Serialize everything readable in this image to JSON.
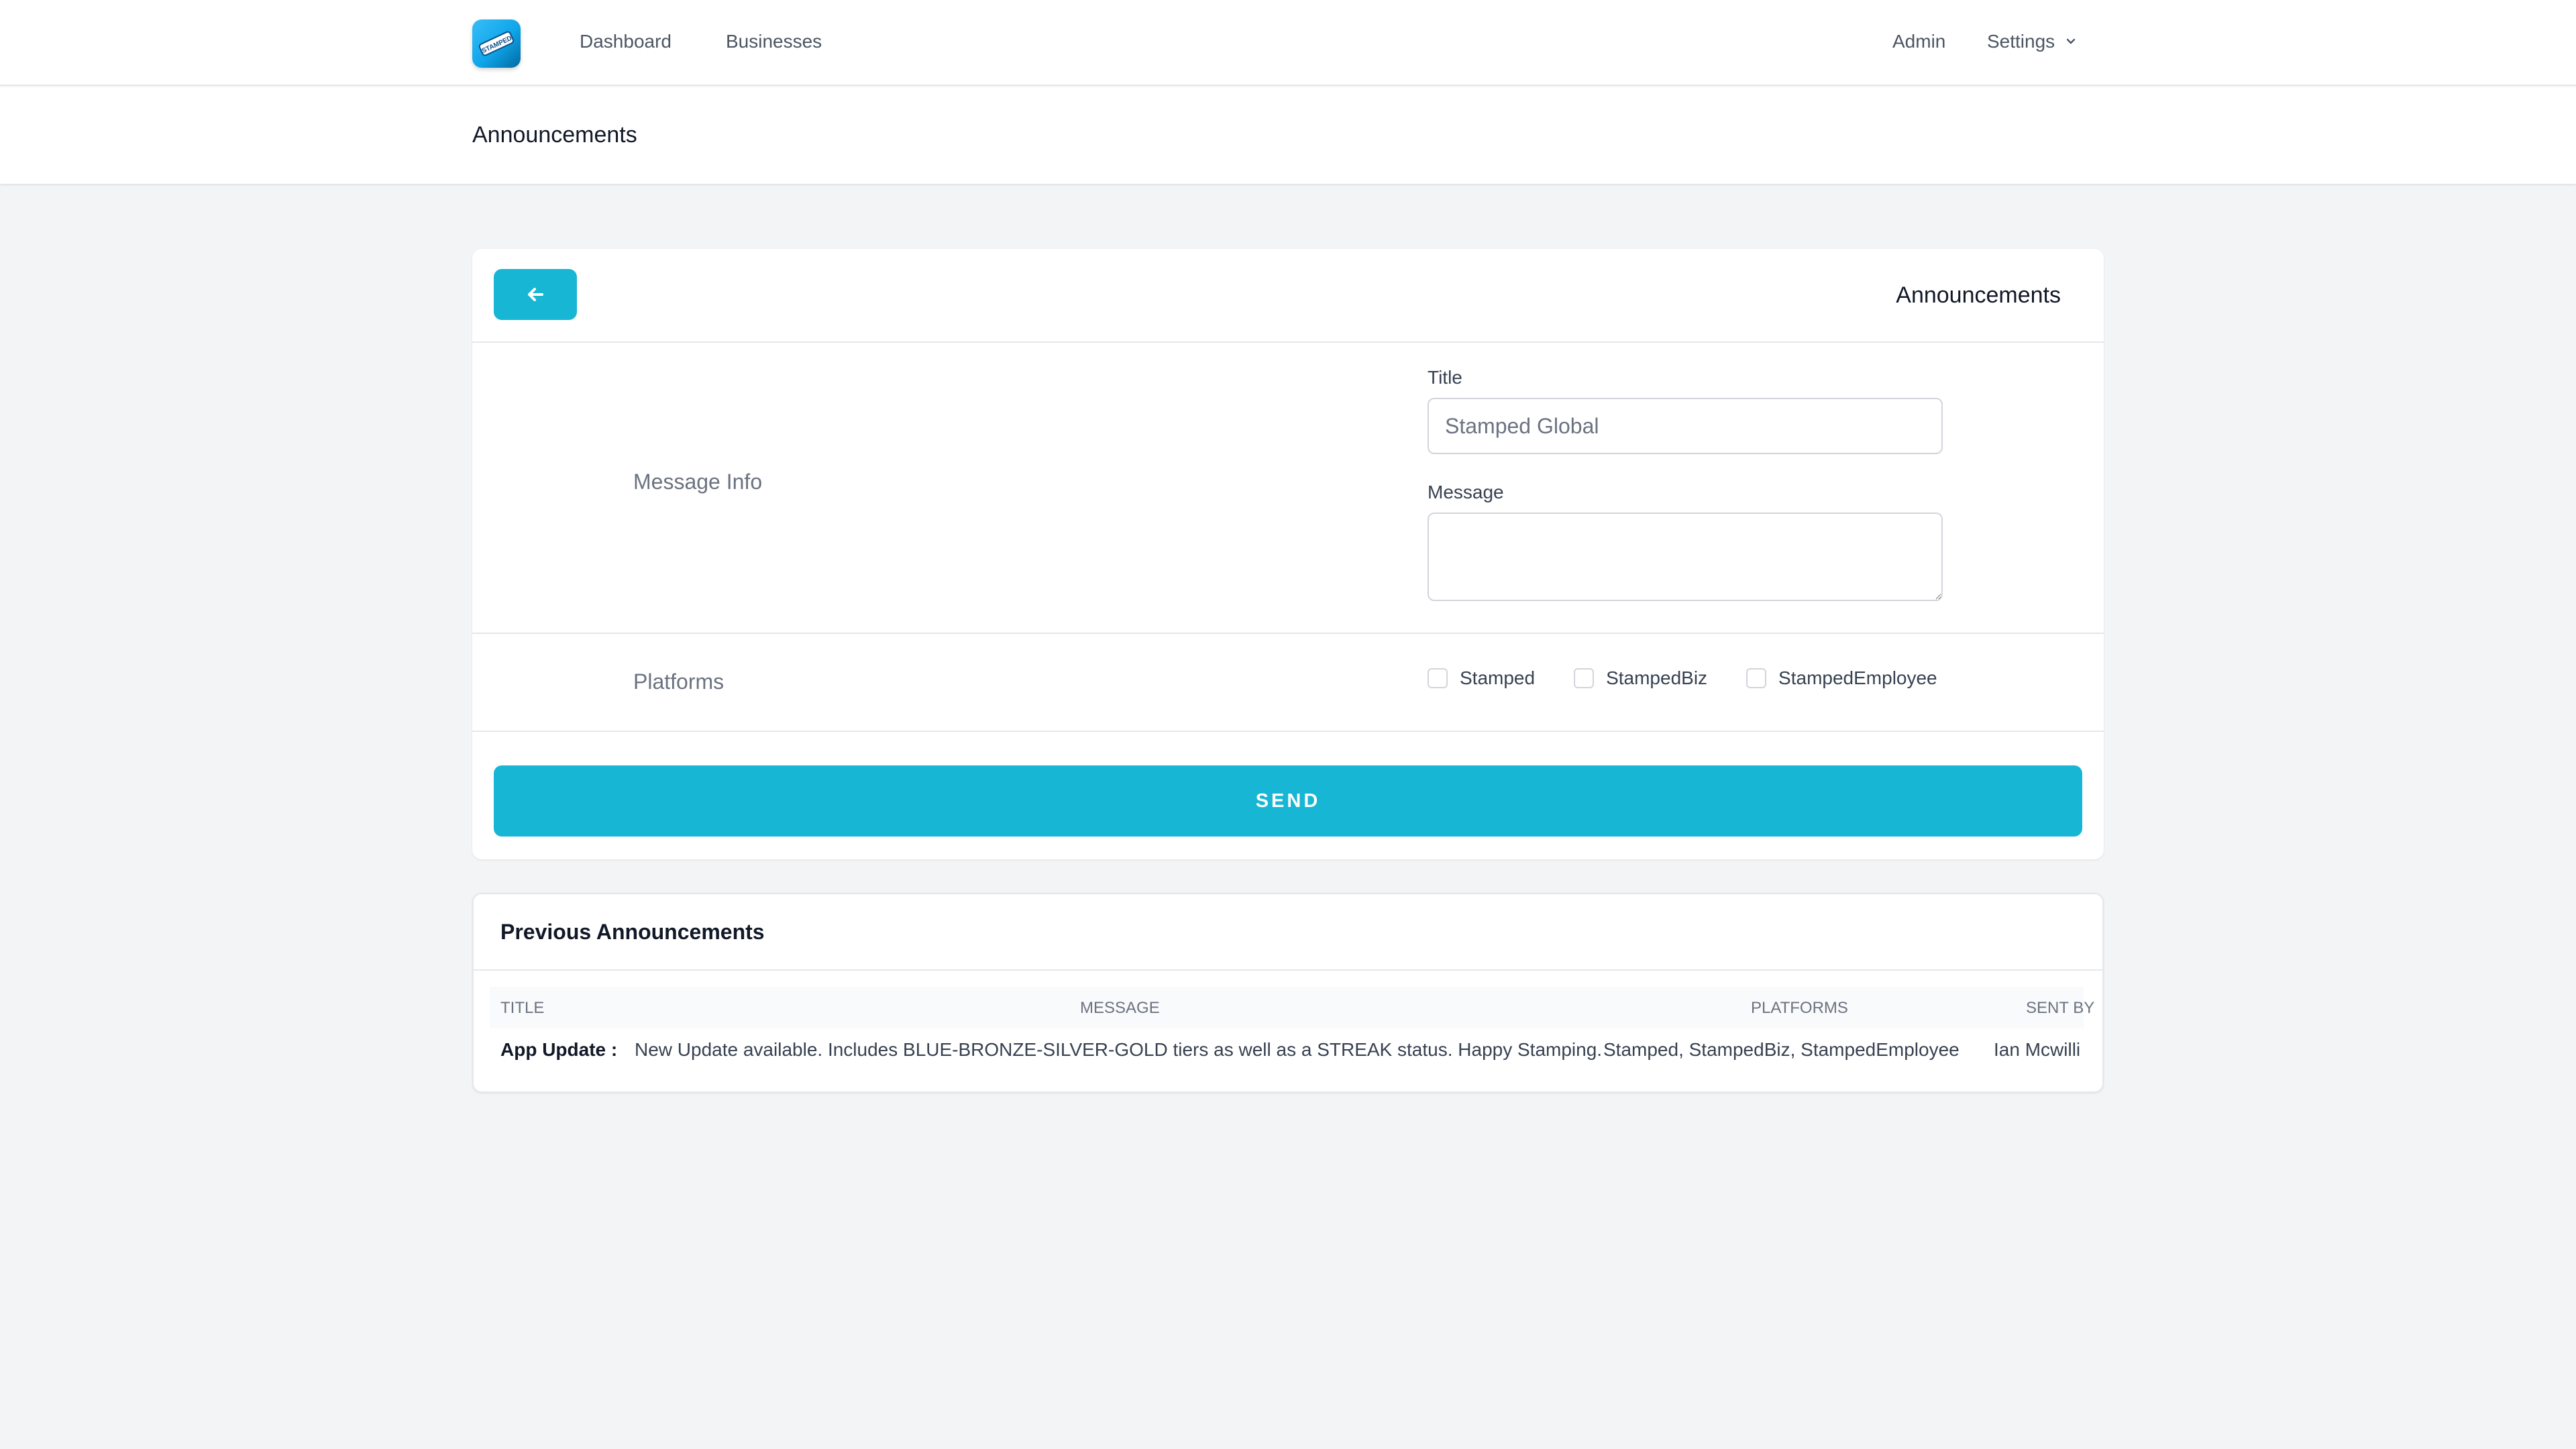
{
  "nav": {
    "logo_text": "STAMPED",
    "links": [
      "Dashboard",
      "Businesses"
    ],
    "admin": "Admin",
    "settings": "Settings"
  },
  "page": {
    "title": "Announcements"
  },
  "form": {
    "title": "Announcements",
    "sections": {
      "message_info": "Message Info",
      "platforms": "Platforms"
    },
    "fields": {
      "title_label": "Title",
      "title_value": "Stamped Global",
      "message_label": "Message",
      "message_value": ""
    },
    "platforms": [
      {
        "label": "Stamped",
        "checked": false
      },
      {
        "label": "StampedBiz",
        "checked": false
      },
      {
        "label": "StampedEmployee",
        "checked": false
      }
    ],
    "send_label": "SEND"
  },
  "previous": {
    "title": "Previous Announcements",
    "columns": [
      "TITLE",
      "MESSAGE",
      "PLATFORMS",
      "SENT BY"
    ],
    "rows": [
      {
        "title": "App Update :",
        "message": "New Update available. Includes BLUE-BRONZE-SILVER-GOLD tiers as well as a STREAK status. Happy Stamping.",
        "platforms": "Stamped, StampedBiz, StampedEmployee",
        "sent_by": "Ian Mcwilli"
      }
    ]
  },
  "colors": {
    "accent": "#17b6d4",
    "background": "#f3f4f6"
  },
  "icons": {
    "back": "arrow-left-icon",
    "settings_caret": "chevron-down-icon"
  }
}
